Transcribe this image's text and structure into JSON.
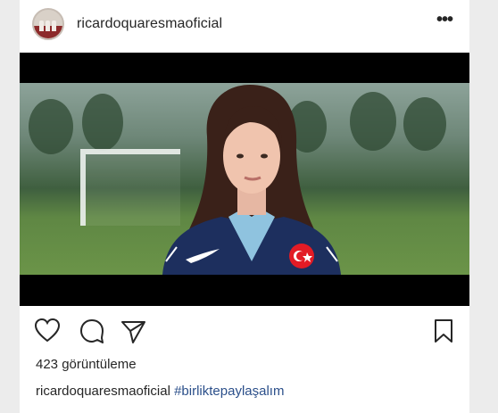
{
  "post": {
    "username": "ricardoquaresmaoficial",
    "more_icon": "•••",
    "views": "423 görüntüleme",
    "caption": {
      "username": "ricardoquaresmaoficial",
      "hashtag": "#birliktepaylaşalım"
    }
  },
  "icons": {
    "like": "heart-icon",
    "comment": "speech-bubble-icon",
    "share": "paper-plane-icon",
    "save": "bookmark-icon"
  },
  "colors": {
    "text": "#262626",
    "hashtag": "#2b4f8a",
    "background": "#ffffff"
  }
}
